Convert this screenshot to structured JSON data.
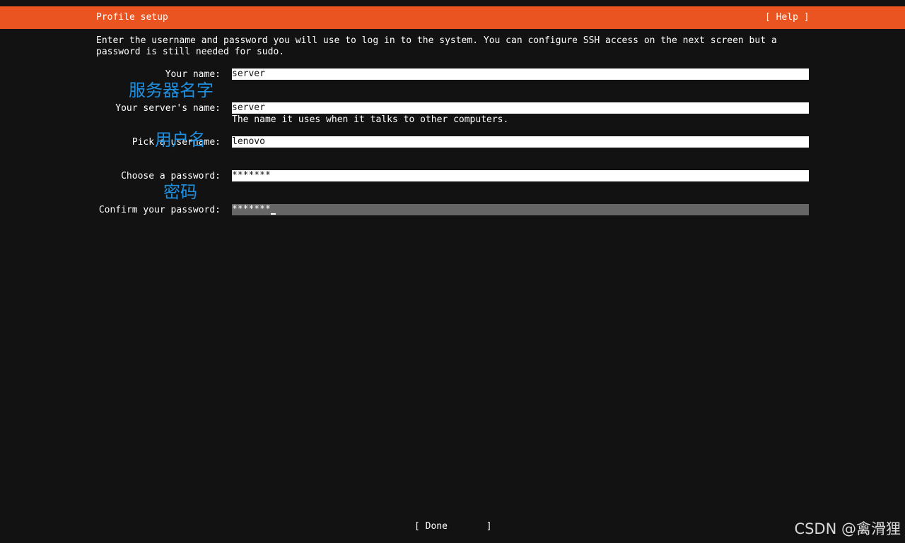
{
  "header": {
    "title": "Profile setup",
    "help_label": "[ Help ]",
    "accent_color": "#e95420"
  },
  "intro": "Enter the username and password you will use to log in to the system. You can configure SSH access on the next screen but a\npassword is still needed for sudo.",
  "form": {
    "your_name": {
      "label": "Your name:",
      "value": "server"
    },
    "server_name": {
      "label": "Your server's name:",
      "value": "server",
      "help": "The name it uses when it talks to other computers."
    },
    "username": {
      "label": "Pick a username:",
      "value": "lenovo"
    },
    "password": {
      "label": "Choose a password:",
      "value": "*******"
    },
    "confirm_password": {
      "label": "Confirm your password:",
      "value": "*******"
    }
  },
  "annotations": {
    "server_name": "服务器名字",
    "username": "用户名",
    "password": "密码"
  },
  "footer": {
    "done_label": "[ Done       ]"
  },
  "watermark": "CSDN @禽滑狸"
}
